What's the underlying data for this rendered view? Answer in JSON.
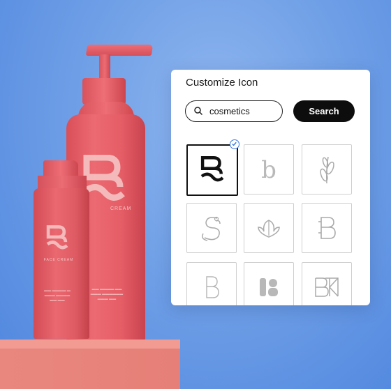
{
  "panel": {
    "title": "Customize Icon",
    "search": {
      "value": "cosmetics"
    },
    "search_button_label": "Search",
    "icons": [
      {
        "name": "b-wave-logo-icon",
        "selected": true
      },
      {
        "name": "serif-b-icon",
        "selected": false
      },
      {
        "name": "leaf-sprig-icon",
        "selected": false
      },
      {
        "name": "hand-s-icon",
        "selected": false
      },
      {
        "name": "shell-icon",
        "selected": false
      },
      {
        "name": "rounded-b-icon",
        "selected": false
      },
      {
        "name": "thin-b-icon",
        "selected": false
      },
      {
        "name": "bold-b-icon",
        "selected": false
      },
      {
        "name": "bk-monogram-icon",
        "selected": false
      }
    ]
  },
  "product": {
    "large_bottle_label": "CREAM",
    "small_bottle_label": "FACE CREAM"
  },
  "colors": {
    "background": "#6f9fe6",
    "bottle": "#e55d66",
    "podium": "#e9877e",
    "check": "#3b78e0"
  }
}
